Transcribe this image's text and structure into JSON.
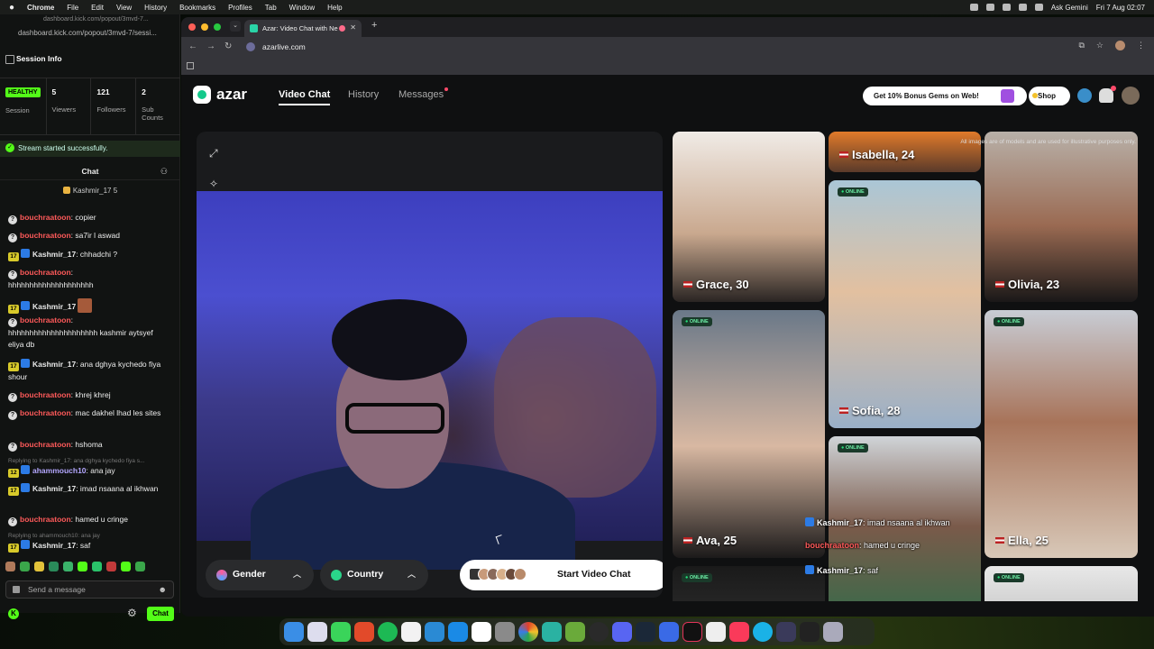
{
  "menubar": {
    "app": "Chrome",
    "items": [
      "File",
      "Edit",
      "View",
      "History",
      "Bookmarks",
      "Profiles",
      "Tab",
      "Window",
      "Help"
    ],
    "ask": "Ask Gemini",
    "clock": "Fri 7 Aug 02:07"
  },
  "kick": {
    "url_faint": "dashboard.kick.com/popout/3mvd-7...",
    "url": "dashboard.kick.com/popout/3mvd-7/sessi...",
    "session_title": "Session Info",
    "healthy": "HEALTHY",
    "session_label": "Session",
    "viewers_value": "5",
    "viewers_label": "Viewers",
    "followers_value": "121",
    "followers_label": "Followers",
    "subs_value": "2",
    "subs_label": "Sub Counts",
    "banner": "Stream started successfully.",
    "chat_header": "Chat",
    "pinned": "Kashmir_17",
    "pinned_suffix": "5",
    "messages": [
      {
        "user": "bouchraatoon",
        "text": ": copier"
      },
      {
        "user": "bouchraatoon",
        "text": ": sa7ir l aswad"
      },
      {
        "user": "Kashmir_17",
        "text": ": chhadchi ?"
      },
      {
        "user": "bouchraatoon",
        "text": ":"
      },
      {
        "user": "",
        "text": "hhhhhhhhhhhhhhhhhhhh"
      },
      {
        "user": "Kashmir_17",
        "text": ":"
      },
      {
        "user": "bouchraatoon",
        "text": ":"
      },
      {
        "user": "",
        "text": "hhhhhhhhhhhhhhhhhhhhh kashmir aytsyef eliya db"
      },
      {
        "user": "Kashmir_17",
        "text": ": ana dghya kychedo fiya shour"
      },
      {
        "user": "bouchraatoon",
        "text": ": khrej khrej"
      },
      {
        "user": "bouchraatoon",
        "text": ": mac dakhel lhad les sites"
      },
      {
        "user": "bouchraatoon",
        "text": ": hshoma"
      },
      {
        "reply": "Replying to Kashmir_17: ana dghya kychedo fiya s..."
      },
      {
        "user": "ahammouch10",
        "text": ": ana jay",
        "level": "12"
      },
      {
        "user": "Kashmir_17",
        "text": ": imad nsaana al ikhwan"
      },
      {
        "user": "bouchraatoon",
        "text": ": hamed u cringe"
      },
      {
        "reply": "Replying to ahammouch10: ana jay"
      },
      {
        "user": "Kashmir_17",
        "text": ": saf"
      }
    ],
    "level17": "17",
    "send_placeholder": "Send a message",
    "chat_button": "Chat"
  },
  "browser": {
    "tab_title": "Azar: Video Chat with Ne",
    "url": "azarlive.com"
  },
  "azar": {
    "brand": "azar",
    "nav": [
      "Video Chat",
      "History",
      "Messages"
    ],
    "promo": "Get 10% Bonus Gems on Web!",
    "shop": "Shop",
    "gender": "Gender",
    "country": "Country",
    "start": "Start Video Chat",
    "disclaimer": "All images are of models and are used for illustrative purposes only.",
    "online": "ONLINE",
    "profiles": [
      {
        "name": "Isabella, 24"
      },
      {
        "name": "Grace, 30"
      },
      {
        "name": "Olivia, 23"
      },
      {
        "name": "Sofia, 28"
      },
      {
        "name": "Ava, 25"
      },
      {
        "name": "Ella, 25"
      }
    ],
    "overlay_chat": [
      {
        "user": "Kashmir_17",
        "text": ": imad nsaana al ikhwan"
      },
      {
        "user": "bouchraatoon",
        "text": ": hamed u cringe"
      },
      {
        "user": "Kashmir_17",
        "text": ": saf"
      }
    ]
  },
  "colors": {
    "kick_green": "#53fc18",
    "azar_green": "#13c98b",
    "username_red": "#ff5a5a"
  }
}
